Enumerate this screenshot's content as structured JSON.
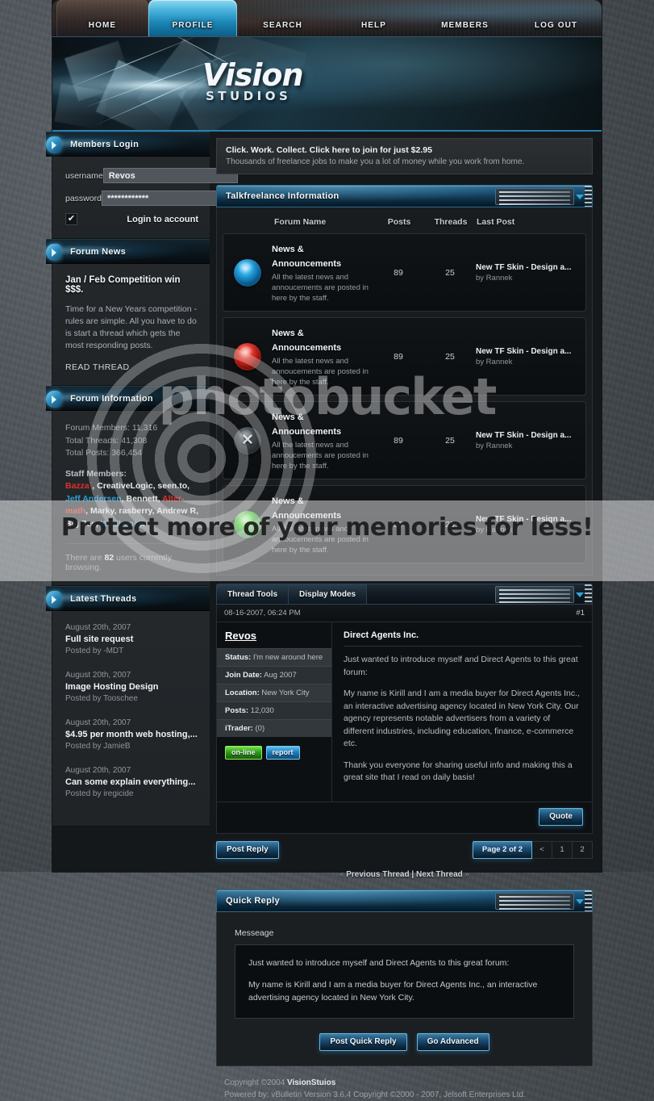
{
  "nav": {
    "items": [
      {
        "label": "HOME",
        "active": false
      },
      {
        "label": "PROFILE",
        "active": true
      },
      {
        "label": "SEARCH",
        "active": false
      },
      {
        "label": "HELP",
        "active": false
      },
      {
        "label": "MEMBERS",
        "active": false
      },
      {
        "label": "LOG OUT",
        "active": false
      }
    ]
  },
  "logo": {
    "main": "Vision",
    "sub": "STUDIOS"
  },
  "sidebar": {
    "login": {
      "heading": "Members Login",
      "username_label": "username",
      "username_value": "Revos",
      "password_label": "password",
      "password_value": "************",
      "remember_checked": "✔",
      "submit_label": "Login to account"
    },
    "news": {
      "heading": "Forum News",
      "title": "Jan / Feb Competition win $$$.",
      "body": "Time for a New Years competition - rules are simple. All you have to do is start a thread which gets the most responding posts.",
      "link": "READ THREAD"
    },
    "info": {
      "heading": "Forum Information",
      "members": "Forum Members: 11,316",
      "threads": "Total Threads: 41,308",
      "posts": "Total Posts: 366,454",
      "staff_label": "Staff Members:",
      "staff": [
        {
          "name": "Bazza`",
          "color": "red"
        },
        {
          "name": "CreativeLogic",
          "color": "white"
        },
        {
          "name": "seen.to",
          "color": "white"
        },
        {
          "name": "Jeff Andersen",
          "color": "blue"
        },
        {
          "name": "Bennett",
          "color": "white"
        },
        {
          "name": "Alter-math",
          "color": "red"
        },
        {
          "name": "Marky",
          "color": "white"
        },
        {
          "name": "rasberry",
          "color": "white"
        },
        {
          "name": "Andrew R",
          "color": "white"
        },
        {
          "name": "Big Zee",
          "color": "white"
        },
        {
          "name": "Wildhoney",
          "color": "blue"
        }
      ],
      "browsing_pre": "There are ",
      "browsing_count": "82",
      "browsing_post": " users currently browsing."
    },
    "latest": {
      "heading": "Latest Threads",
      "items": [
        {
          "date": "August 20th, 2007",
          "title": "Full site request",
          "by": "Posted by -MDT"
        },
        {
          "date": "August 20th, 2007",
          "title": "Image Hosting Design",
          "by": "Posted by Tooschee"
        },
        {
          "date": "August 20th, 2007",
          "title": "$4.95 per month web hosting,...",
          "by": "Posted by JamieB"
        },
        {
          "date": "August 20th, 2007",
          "title": "Can some explain everything...",
          "by": "Posted by iregicide"
        }
      ]
    }
  },
  "ad": {
    "headline": "Click. Work. Collect. Click here to join for just $2.95",
    "sub": "Thousands of freelance jobs to make you a lot of money while you work from home."
  },
  "forum_section": {
    "heading": "Talkfreelance Information",
    "columns": {
      "name": "Forum Name",
      "posts": "Posts",
      "threads": "Threads",
      "last": "Last Post"
    },
    "rows": [
      {
        "icon": "orb-blue",
        "name": "News & Announcements",
        "desc": "All the latest news and annoucements are posted in here by the staff.",
        "posts": "89",
        "threads": "25",
        "last_title": "New TF Skin - Design a...",
        "last_by": "by Rannek"
      },
      {
        "icon": "orb-red",
        "name": "News & Announcements",
        "desc": "All the latest news and annoucements are posted in here by the staff.",
        "posts": "89",
        "threads": "25",
        "last_title": "New TF Skin - Design a...",
        "last_by": "by Rannek"
      },
      {
        "icon": "orb-off",
        "name": "News & Announcements",
        "desc": "All the latest news and annoucements are posted in here by the staff.",
        "posts": "89",
        "threads": "25",
        "last_title": "New TF Skin - Design a...",
        "last_by": "by Rannek"
      },
      {
        "icon": "orb-green",
        "name": "News & Announcements",
        "desc": "All the latest news and annoucements are posted in here by the staff.",
        "posts": "89",
        "threads": "25",
        "last_title": "New TF Skin - Design a...",
        "last_by": "by Rannek"
      }
    ]
  },
  "thread": {
    "tools": {
      "thread_tools": "Thread Tools",
      "display_modes": "Display Modes"
    },
    "post": {
      "timestamp": "08-16-2007, 06:24 PM",
      "number": "#1",
      "user": {
        "name": "Revos",
        "status_label": "Status:",
        "status_value": "I'm new around here",
        "join_label": "Join Date:",
        "join_value": "Aug 2007",
        "location_label": "Location:",
        "location_value": "New York City",
        "posts_label": "Posts:",
        "posts_value": "12,030",
        "itrader_label": "iTrader:",
        "itrader_value": "(0)",
        "online_btn": "on-line",
        "report_btn": "report"
      },
      "title": "Direct Agents Inc.",
      "paragraphs": [
        "Just wanted to introduce myself and Direct Agents to this great forum:",
        "My name is Kirill and I am a media buyer for Direct Agents Inc., an interactive advertising agency located in New York City. Our agency represents notable advertisers from a variety of different industries, including education, finance, e-commerce etc.",
        "Thank you everyone for sharing useful info and making this a great site that I read on daily basis!"
      ],
      "quote_btn": "Quote"
    },
    "post_reply_btn": "Post Reply",
    "pager": {
      "label": "Page 2 of 2",
      "prev": "<",
      "pages": [
        "1",
        "2"
      ]
    },
    "nav": {
      "prev_chev": "«",
      "prev": "Previous Thread",
      "sep": "|",
      "next": "Next Thread",
      "next_chev": "»"
    }
  },
  "quick_reply": {
    "heading": "Quick Reply",
    "message_label": "Messeage",
    "message_paragraphs": [
      "Just wanted to introduce myself and Direct Agents to this great forum:",
      "My name is Kirill and I am a media buyer for Direct Agents Inc., an interactive advertising agency located in New York City."
    ],
    "post_btn": "Post Quick Reply",
    "advanced_btn": "Go Advanced"
  },
  "footer": {
    "copyright_pre": "Copyright ©2004 ",
    "copyright_name": "VisionStuios",
    "powered": "Powered by: vBulletin Version 3.6.4 Copyright ©2000 - 2007, Jelsoft Enterprises Ltd."
  },
  "watermark": {
    "brand": "photobucket",
    "tagline": "Protect more of your memories for less!"
  }
}
